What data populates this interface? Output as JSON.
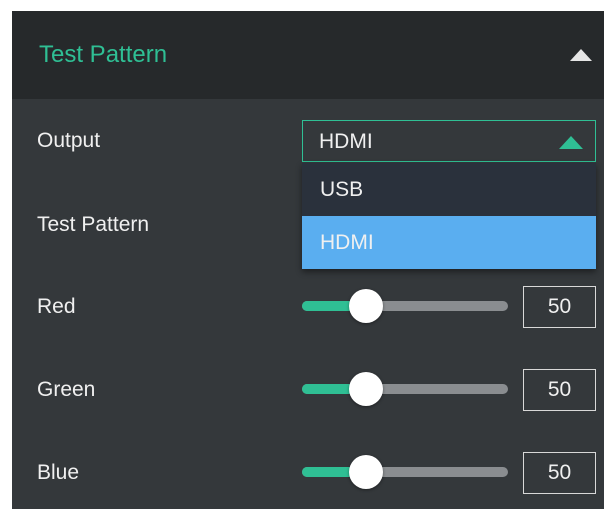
{
  "panel": {
    "title": "Test Pattern",
    "collapse_icon": "triangle-up-icon"
  },
  "output": {
    "label": "Output",
    "selected": "HDMI",
    "arrow_icon": "triangle-up-icon",
    "options": [
      "USB",
      "HDMI"
    ],
    "highlighted_option": "HDMI"
  },
  "test_pattern": {
    "label": "Test Pattern"
  },
  "channels": {
    "red": {
      "label": "Red",
      "value": "50",
      "level": 0.25
    },
    "green": {
      "label": "Green",
      "value": "50",
      "level": 0.25
    },
    "blue": {
      "label": "Blue",
      "value": "50",
      "level": 0.25
    }
  },
  "colors": {
    "accent": "#2fbf94",
    "panel_bg": "#34383b",
    "header_bg": "#26292b",
    "option_selected_bg": "#5aaef0",
    "option_bg": "#2a313c",
    "track": "#8a8d90"
  }
}
